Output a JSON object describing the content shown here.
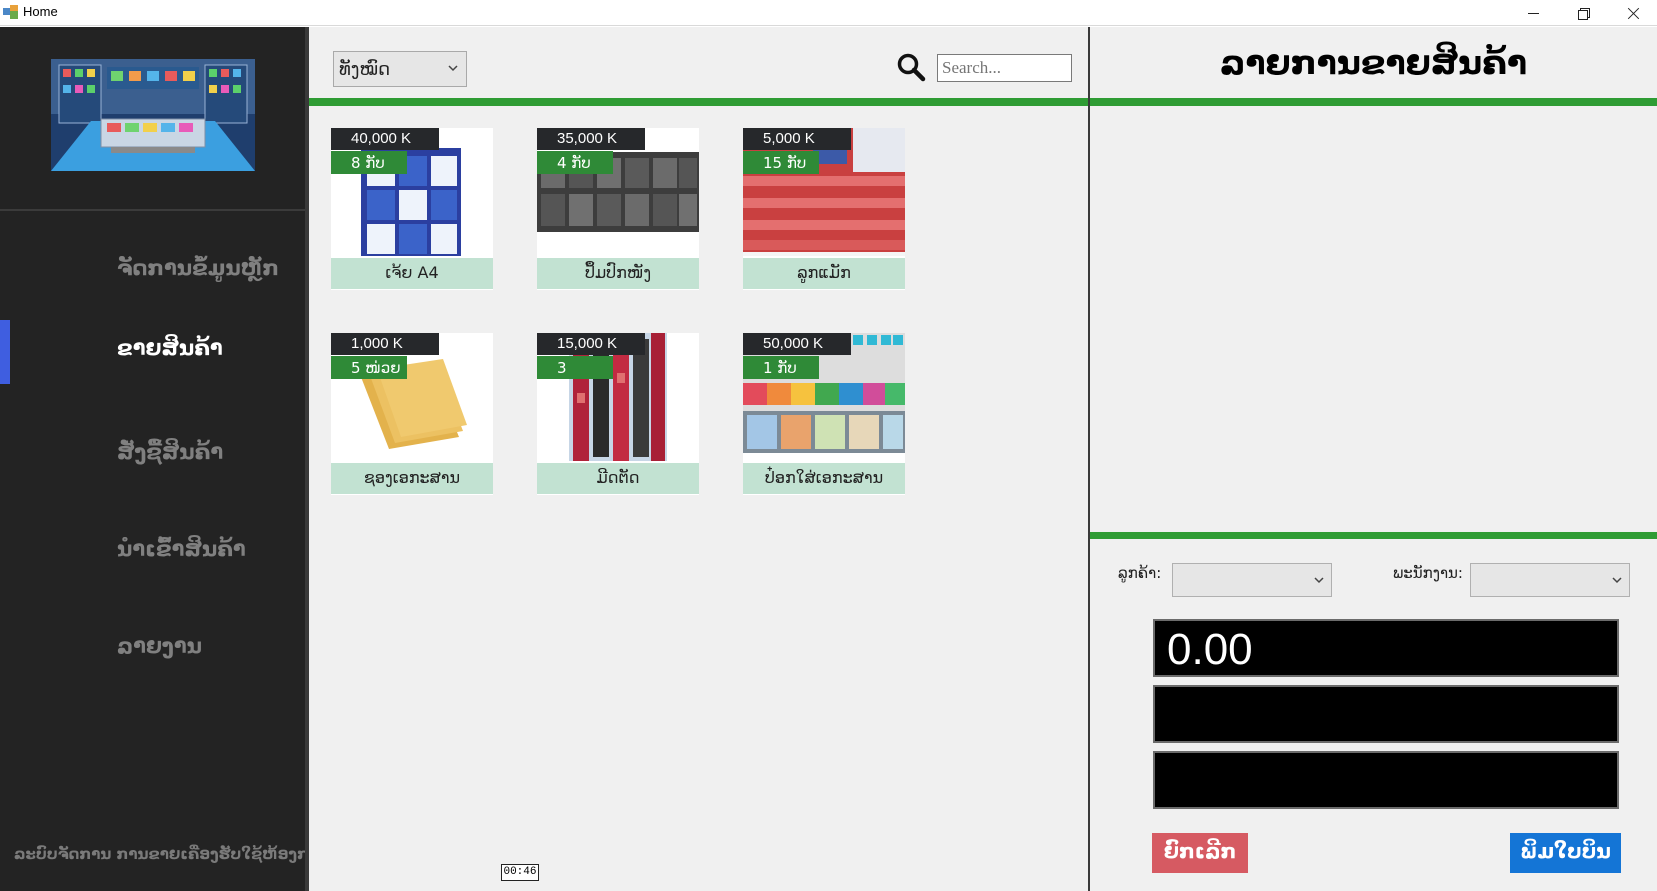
{
  "window": {
    "title": "Home"
  },
  "sidebar": {
    "items": [
      {
        "label": "ຈັດການຂໍ້ມູນຫຼັກ"
      },
      {
        "label": "ຂາຍສິນຄ້າ"
      },
      {
        "label": "ສັ່ງຊື້ສິນຄ້າ"
      },
      {
        "label": "ນຳເຂົ້າສິນຄ້າ"
      },
      {
        "label": "ລາຍງານ"
      }
    ],
    "active_index": 1,
    "footer": "ລະບົບຈັດການ ການຂາຍເຄື່ອງຮັບໃຊ້ຫ້ອງການ"
  },
  "center": {
    "category_filter": {
      "selected": "ທັງໝົດ"
    },
    "search": {
      "placeholder": "Search..."
    },
    "products": [
      {
        "price": "40,000 K",
        "qty": "8 ກັບ",
        "name": "ເຈ້ຍ A4"
      },
      {
        "price": "35,000 K",
        "qty": "4 ກັບ",
        "name": "ປຶ້ມປົກໜັງ"
      },
      {
        "price": "5,000 K",
        "qty": "15 ກັບ",
        "name": "ລູກແມັກ"
      },
      {
        "price": "1,000 K",
        "qty": "5 ໜ່ວຍ",
        "name": "ຊອງເອກະສານ"
      },
      {
        "price": "15,000 K",
        "qty": "3",
        "name": "ມີດຕັດ"
      },
      {
        "price": "50,000 K",
        "qty": "1 ກັບ",
        "name": "ປ໋ອກໃສ່ເອກະສານ"
      }
    ],
    "timer": "00:46"
  },
  "right_panel": {
    "title": "ລາຍການຂາຍສິນຄ້າ",
    "customer_label": "ລູກຄ້າ:",
    "employee_label": "ພະນັກງານ:",
    "total_display": "0.00",
    "cancel_label": "ຍົກເລີກ",
    "print_label": "ພິມໃບບິນ"
  },
  "colors": {
    "sidebar_bg": "#232323",
    "accent_green": "#2f9c34",
    "active_indicator": "#3f5ee0",
    "cancel_red": "#d65a62",
    "print_blue": "#1475d6",
    "product_label_bg": "#c2e2d2"
  },
  "icons": [
    "app-icon",
    "minimize-icon",
    "restore-icon",
    "close-icon",
    "search-icon",
    "chevron-down-icon"
  ]
}
